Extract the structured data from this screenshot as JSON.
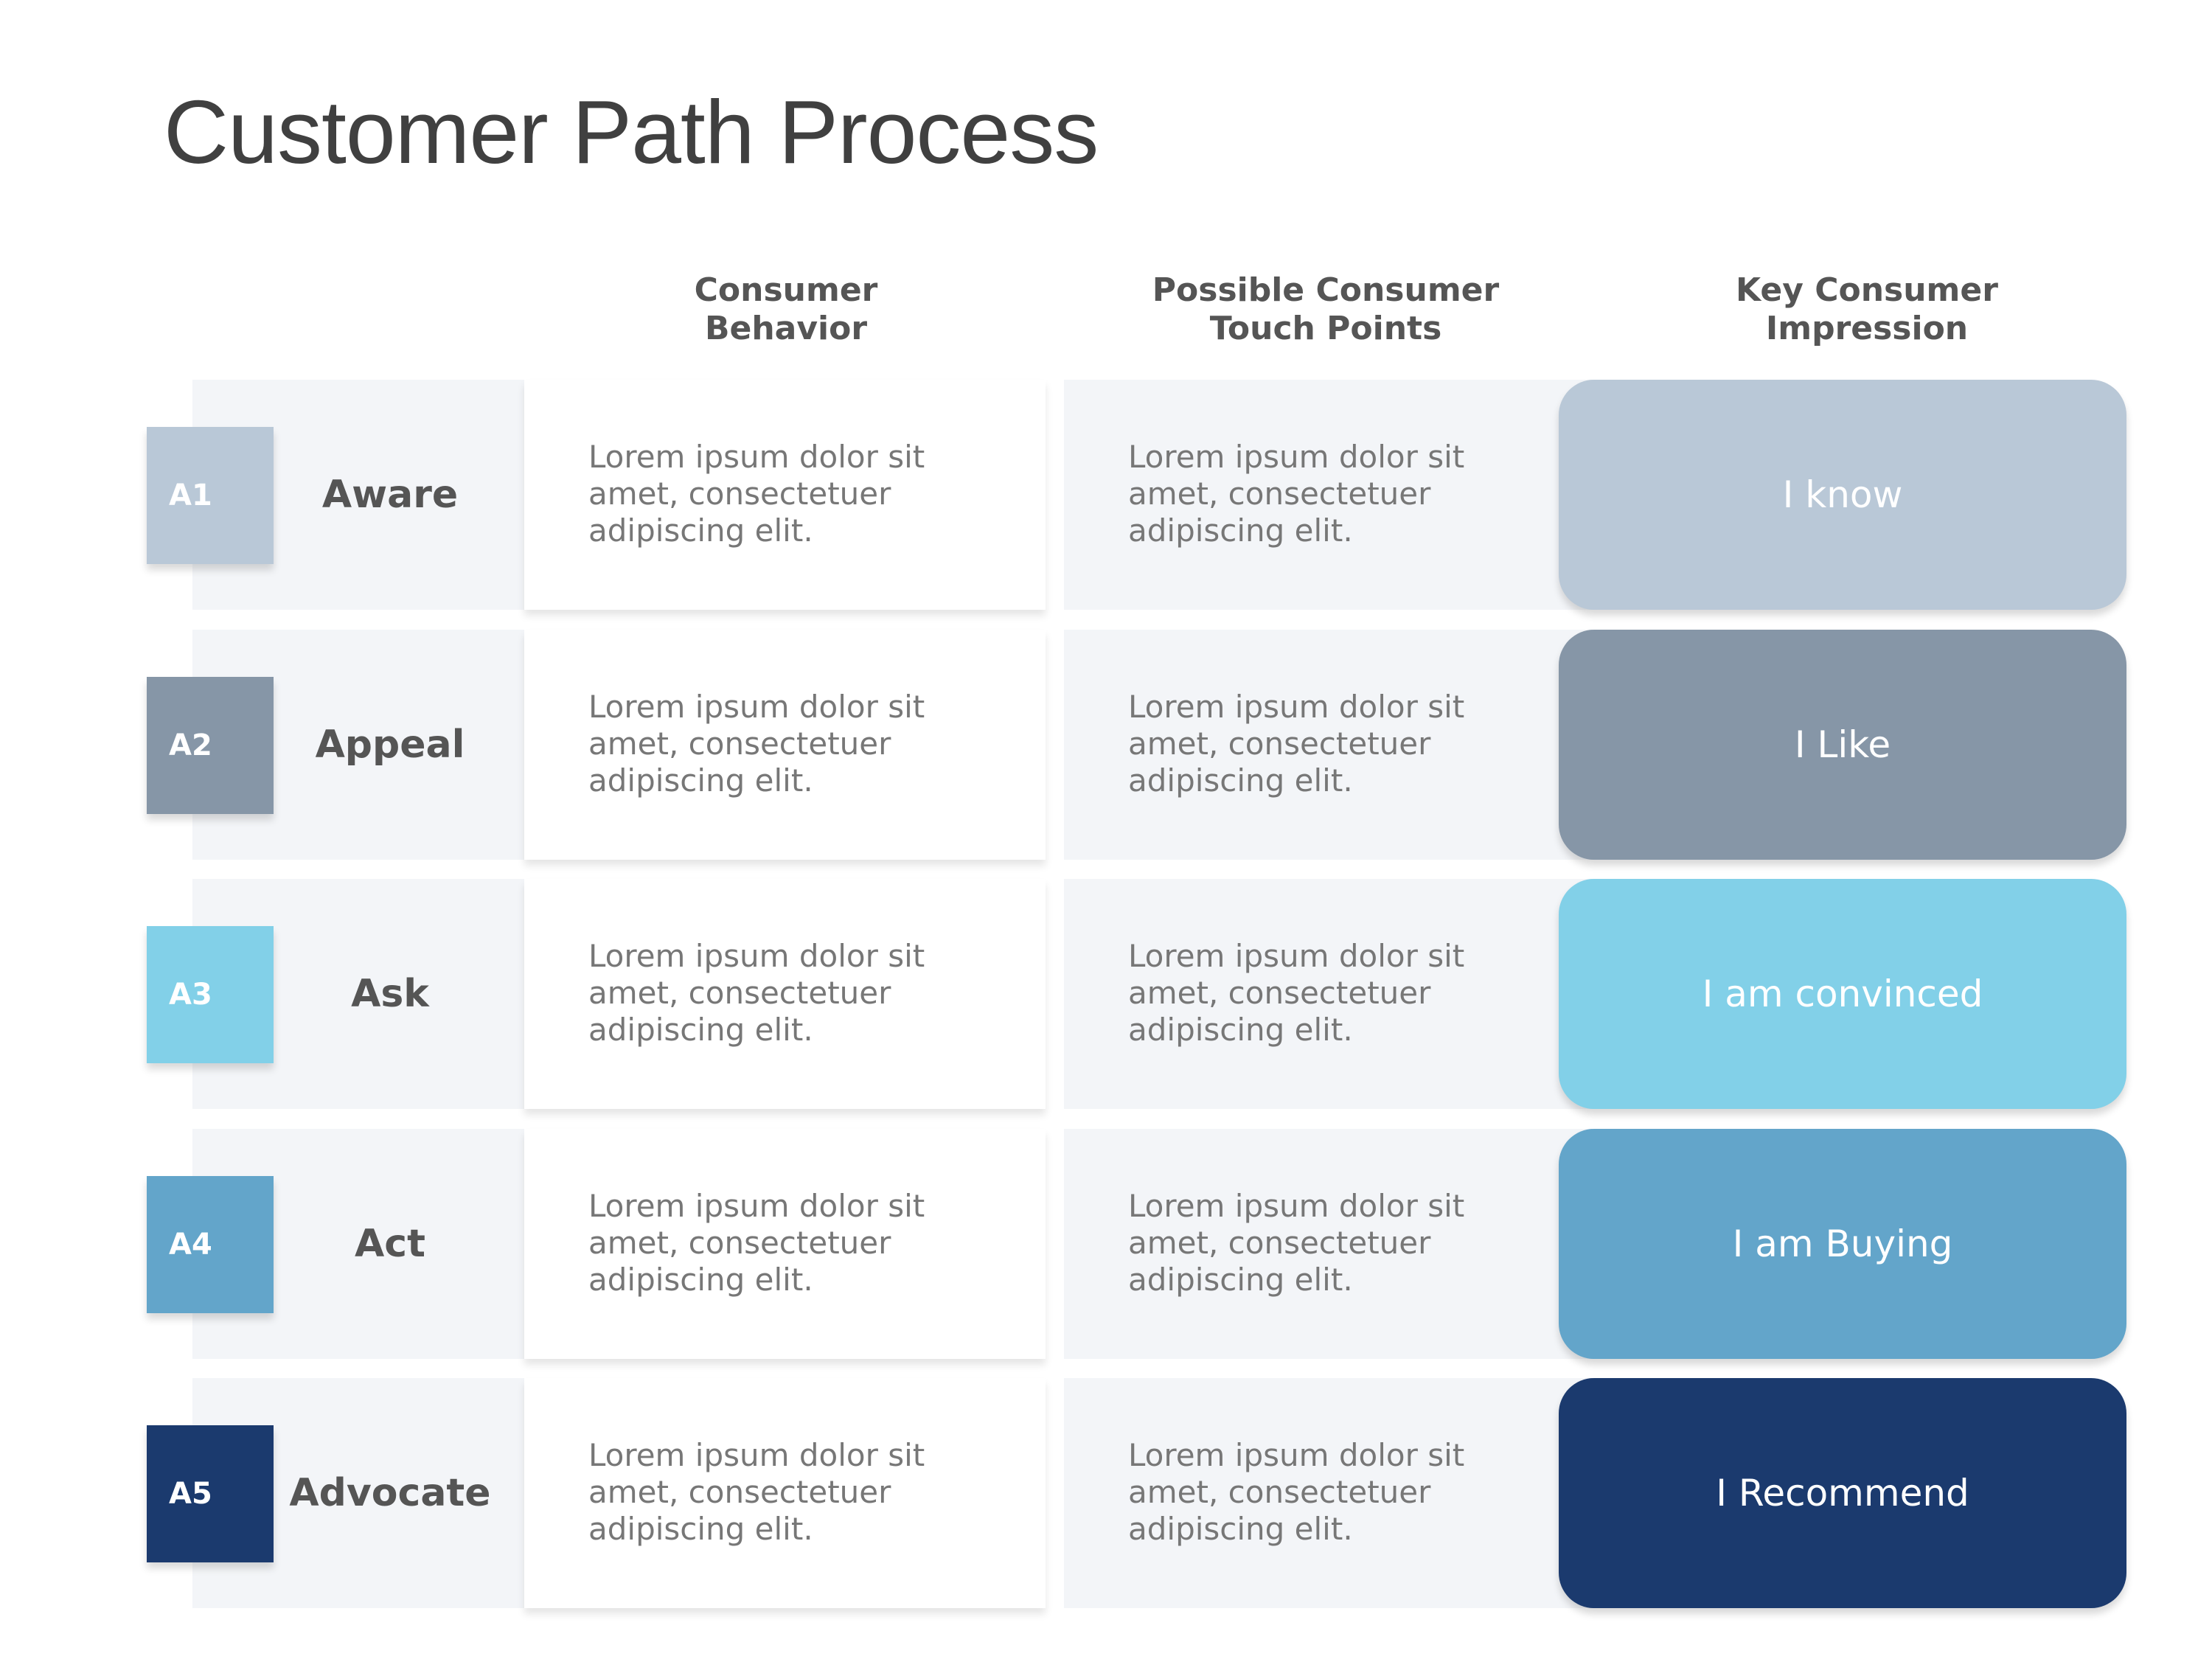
{
  "title": "Customer Path Process",
  "columns": [
    "Consumer\nBehavior",
    "Possible Consumer\nTouch Points",
    "Key Consumer\nImpression"
  ],
  "rows": [
    {
      "badge": "A1",
      "label": "Aware",
      "behavior": "Lorem ipsum dolor sit amet, consectetuer adipiscing elit.",
      "touch": "Lorem ipsum dolor sit amet, consectetuer adipiscing elit.",
      "impression": "I know",
      "color": "#B9C8D7"
    },
    {
      "badge": "A2",
      "label": "Appeal",
      "behavior": "Lorem ipsum dolor sit amet, consectetuer adipiscing elit.",
      "touch": "Lorem ipsum dolor sit amet, consectetuer adipiscing elit.",
      "impression": "I Like",
      "color": "#8696A7"
    },
    {
      "badge": "A3",
      "label": "Ask",
      "behavior": "Lorem ipsum dolor sit amet, consectetuer adipiscing elit.",
      "touch": "Lorem ipsum dolor sit amet, consectetuer adipiscing elit.",
      "impression": "I am convinced",
      "color": "#82D0E8"
    },
    {
      "badge": "A4",
      "label": "Act",
      "behavior": "Lorem ipsum dolor sit amet, consectetuer adipiscing elit.",
      "touch": "Lorem ipsum dolor sit amet, consectetuer adipiscing elit.",
      "impression": "I am Buying",
      "color": "#63A5CA"
    },
    {
      "badge": "A5",
      "label": "Advocate",
      "behavior": "Lorem ipsum dolor sit amet, consectetuer adipiscing elit.",
      "touch": "Lorem ipsum dolor sit amet, consectetuer adipiscing elit.",
      "impression": "I Recommend",
      "color": "#1B3A6E"
    }
  ]
}
